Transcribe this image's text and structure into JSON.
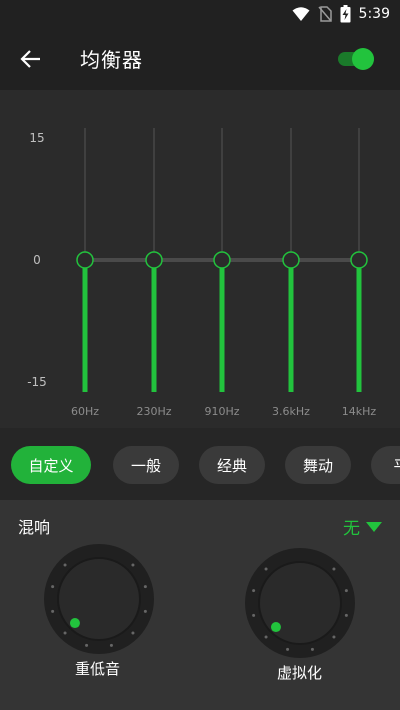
{
  "status": {
    "time": "5:39"
  },
  "header": {
    "title": "均衡器",
    "enabled": true
  },
  "equalizer": {
    "y_max_label": "15",
    "y_mid_label": "0",
    "y_min_label": "-15",
    "bands": [
      {
        "label": "60Hz",
        "gain": 0
      },
      {
        "label": "230Hz",
        "gain": 0
      },
      {
        "label": "910Hz",
        "gain": 0
      },
      {
        "label": "3.6kHz",
        "gain": 0
      },
      {
        "label": "14kHz",
        "gain": 0
      }
    ]
  },
  "presets": [
    {
      "label": "自定义",
      "active": true
    },
    {
      "label": "一般",
      "active": false
    },
    {
      "label": "经典",
      "active": false
    },
    {
      "label": "舞动",
      "active": false
    },
    {
      "label": "平",
      "active": false
    }
  ],
  "reverb": {
    "title": "混响",
    "selected": "无",
    "knobs": [
      {
        "label": "重低音",
        "level": 0
      },
      {
        "label": "虚拟化",
        "level": 0
      }
    ]
  },
  "colors": {
    "accent": "#22c33d",
    "background": "#262626"
  }
}
